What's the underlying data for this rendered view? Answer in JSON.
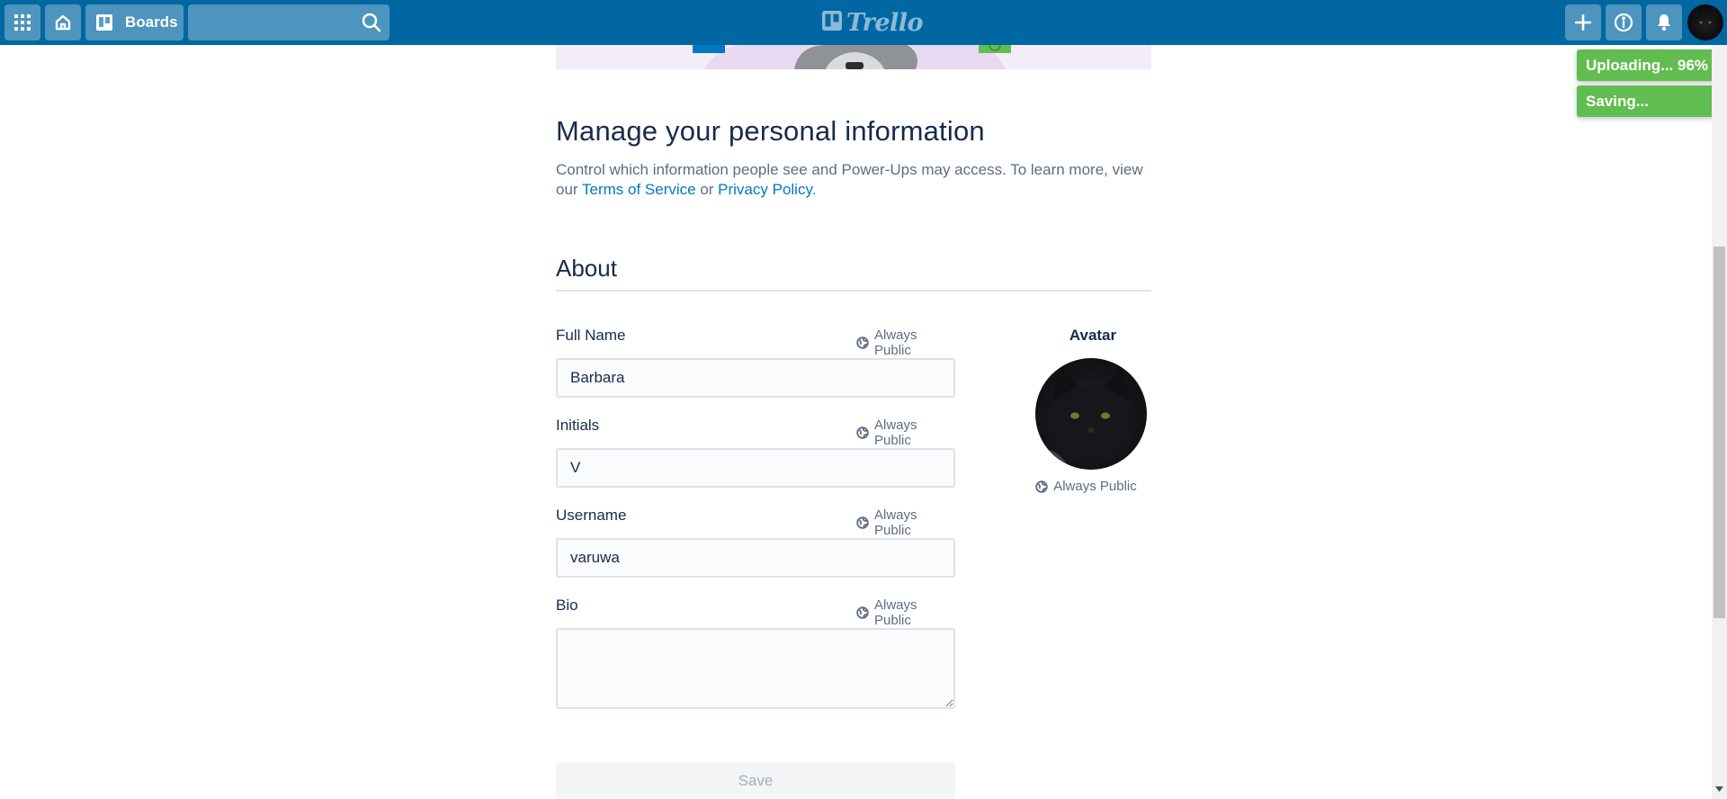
{
  "header": {
    "apps_icon": "grid-icon",
    "home_icon": "home-icon",
    "boards_label": "Boards",
    "search_value": "",
    "logo_text": "Trello",
    "create_icon": "plus-icon",
    "info_icon": "info-icon",
    "notifications_icon": "bell-icon",
    "bg_color": "#0067a3"
  },
  "toasts": [
    {
      "text": "Uploading... 96%"
    },
    {
      "text": "Saving..."
    }
  ],
  "toast_color": "#61bd4f",
  "page": {
    "title": "Manage your personal information",
    "description_prefix": "Control which information people see and Power-Ups may access. To learn more, view our ",
    "terms_link": "Terms of Service",
    "description_or": " or ",
    "privacy_link": "Privacy Policy",
    "description_suffix": "."
  },
  "about": {
    "section_title": "About",
    "fields": [
      {
        "label": "Full Name",
        "visibility": "Always Public",
        "value": "Barbara"
      },
      {
        "label": "Initials",
        "visibility": "Always Public",
        "value": "V"
      },
      {
        "label": "Username",
        "visibility": "Always Public",
        "value": "varuwa"
      },
      {
        "label": "Bio",
        "visibility": "Always Public",
        "value": ""
      }
    ],
    "save_label": "Save",
    "avatar": {
      "label": "Avatar",
      "visibility": "Always Public"
    }
  },
  "colors": {
    "link": "#0079bf",
    "text": "#172b4d",
    "muted": "#5e6c84"
  }
}
